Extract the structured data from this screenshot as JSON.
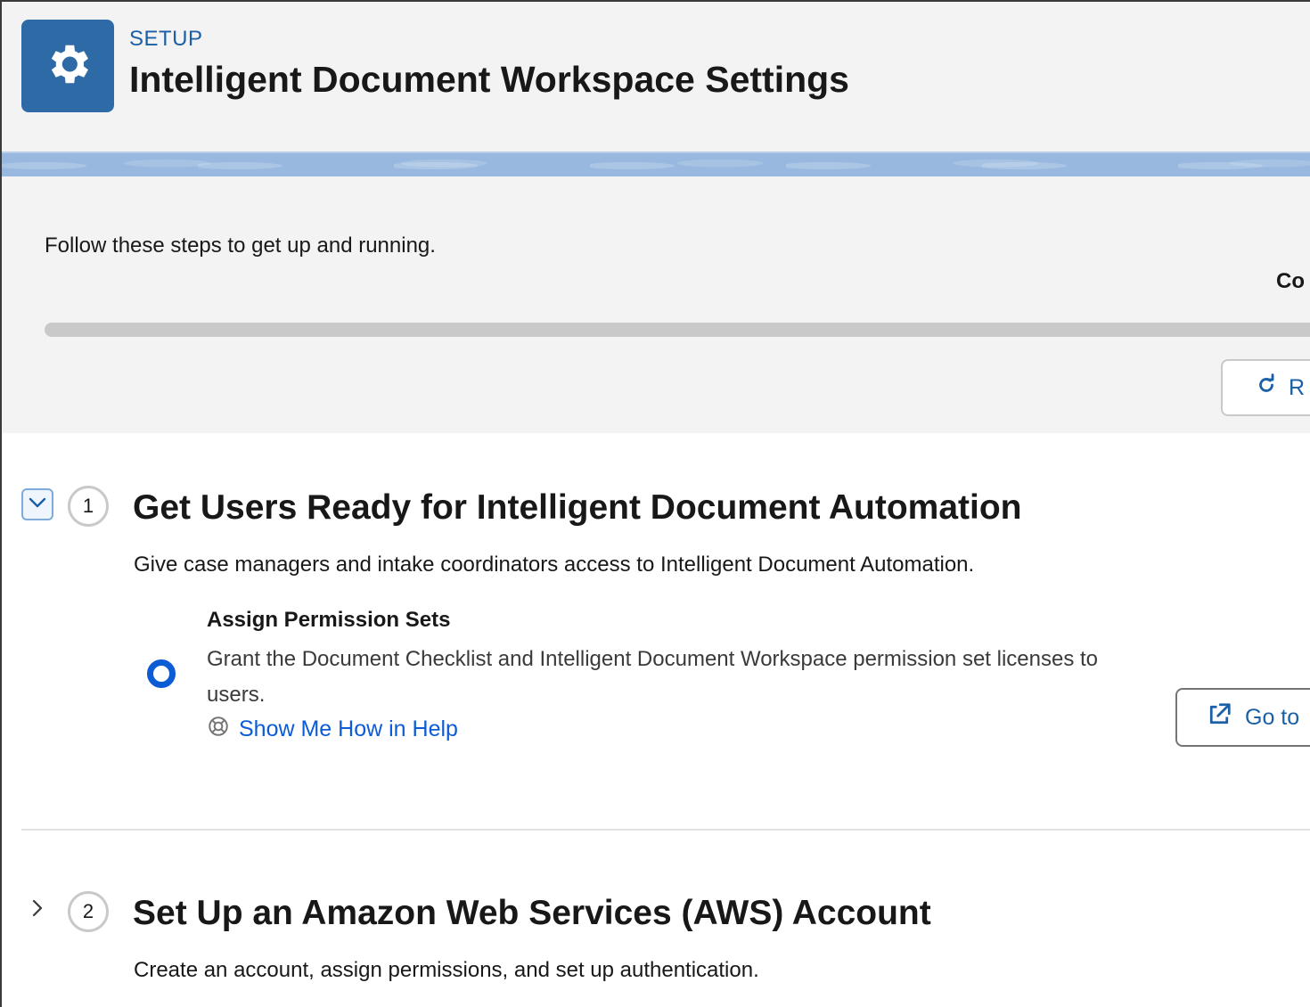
{
  "header": {
    "kicker": "SETUP",
    "title": "Intelligent Document Workspace Settings",
    "icon": "gear-icon",
    "tile_color": "#2e6aa6"
  },
  "progress": {
    "intro": "Follow these steps to get up and running.",
    "complete_label": "Co",
    "percent": 0,
    "refresh_label": "R",
    "refresh_icon": "refresh-icon"
  },
  "steps": [
    {
      "number": "1",
      "expanded": true,
      "title": "Get Users Ready for Intelligent Document Automation",
      "description": "Give case managers and intake coordinators access to Intelligent Document Automation.",
      "task": {
        "title": "Assign Permission Sets",
        "description": "Grant the Document Checklist and Intelligent Document Workspace permission set licenses to users.",
        "help_label": "Show Me How in Help",
        "help_icon": "help-lifebuoy-icon",
        "button_label": "Go to",
        "button_icon": "external-link-icon"
      }
    },
    {
      "number": "2",
      "expanded": false,
      "title": "Set Up an Amazon Web Services (AWS) Account",
      "description": "Create an account, assign permissions, and set up authentication."
    }
  ],
  "colors": {
    "brand_blue": "#0b5cd5",
    "link_blue": "#1b5fa7",
    "band": "#98b8df"
  }
}
